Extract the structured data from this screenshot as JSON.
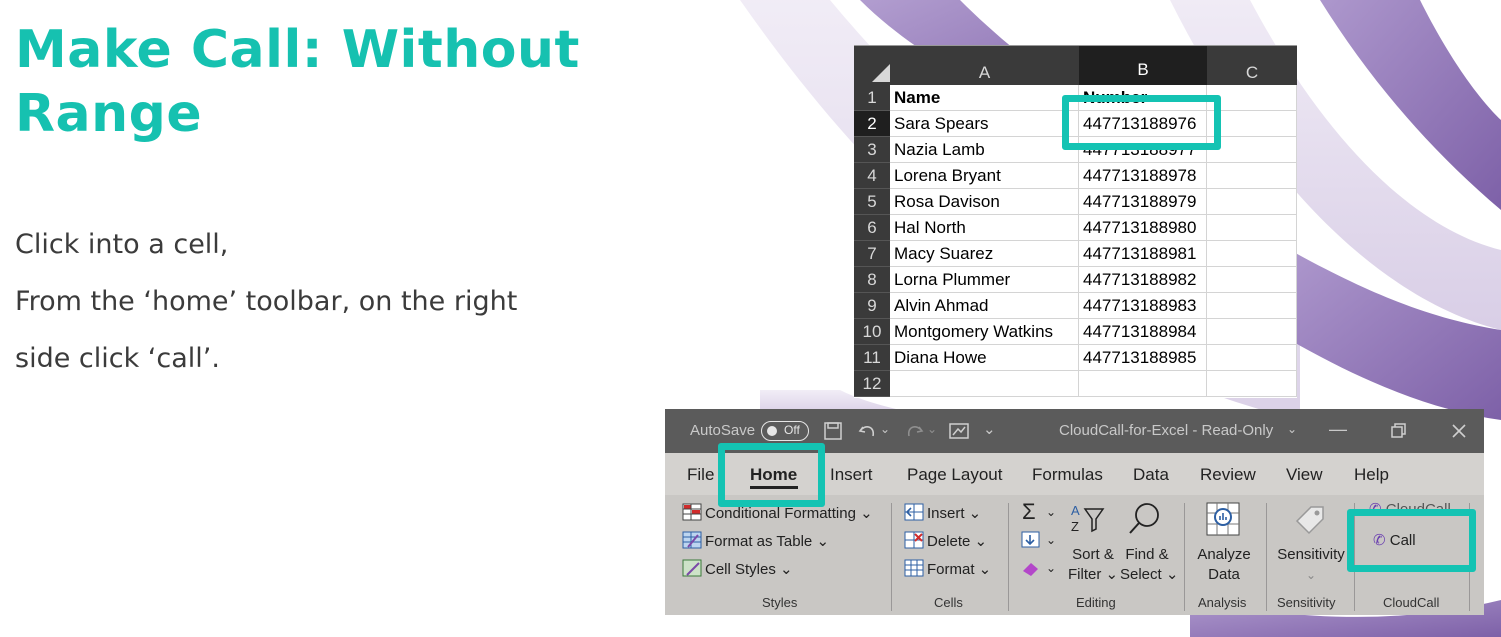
{
  "slide": {
    "title_line1": "Make Call: Without",
    "title_line2": "Range",
    "instructions": [
      "Click into a cell,",
      "From the ‘home’ toolbar, on the right",
      "side click ‘call’."
    ]
  },
  "colors": {
    "accent_teal": "#16c1b0",
    "swoosh_purple": "#8b6fb3",
    "excel_header": "#3a3a3a"
  },
  "spreadsheet": {
    "columns": [
      "A",
      "B",
      "C"
    ],
    "selected_column": "B",
    "rows": [
      {
        "num": "1",
        "name": "Name",
        "number": "Number"
      },
      {
        "num": "2",
        "name": "Sara Spears",
        "number": "447713188976"
      },
      {
        "num": "3",
        "name": "Nazia Lamb",
        "number": "447713188977"
      },
      {
        "num": "4",
        "name": "Lorena Bryant",
        "number": "447713188978"
      },
      {
        "num": "5",
        "name": "Rosa Davison",
        "number": "447713188979"
      },
      {
        "num": "6",
        "name": "Hal North",
        "number": "447713188980"
      },
      {
        "num": "7",
        "name": "Macy Suarez",
        "number": "447713188981"
      },
      {
        "num": "8",
        "name": "Lorna Plummer",
        "number": "447713188982"
      },
      {
        "num": "9",
        "name": "Alvin Ahmad",
        "number": "447713188983"
      },
      {
        "num": "10",
        "name": "Montgomery Watkins",
        "number": "447713188984"
      },
      {
        "num": "11",
        "name": "Diana Howe",
        "number": "447713188985"
      },
      {
        "num": "12",
        "name": "",
        "number": ""
      }
    ],
    "selected_row": "2"
  },
  "excel": {
    "autosave_label": "AutoSave",
    "autosave_state": "Off",
    "document_title": "CloudCall-for-Excel - Read-Only",
    "tabs": [
      "File",
      "Home",
      "Insert",
      "Page Layout",
      "Formulas",
      "Data",
      "Review",
      "View",
      "Help"
    ],
    "active_tab": "Home",
    "styles": {
      "conditional_formatting": "Conditional Formatting",
      "format_as_table": "Format as Table",
      "cell_styles": "Cell Styles",
      "group_label": "Styles"
    },
    "cells": {
      "insert": "Insert",
      "delete": "Delete",
      "format": "Format",
      "group_label": "Cells"
    },
    "editing": {
      "sort_filter_line1": "Sort &",
      "sort_filter_line2": "Filter",
      "find_select_line1": "Find &",
      "find_select_line2": "Select",
      "group_label": "Editing"
    },
    "analysis": {
      "analyze_line1": "Analyze",
      "analyze_line2": "Data",
      "group_label": "Analysis"
    },
    "sensitivity": {
      "button": "Sensitivity",
      "group_label": "Sensitivity"
    },
    "cloudcall": {
      "cloudcall_button": "CloudCall",
      "call_button": "Call",
      "group_label": "CloudCall"
    }
  }
}
